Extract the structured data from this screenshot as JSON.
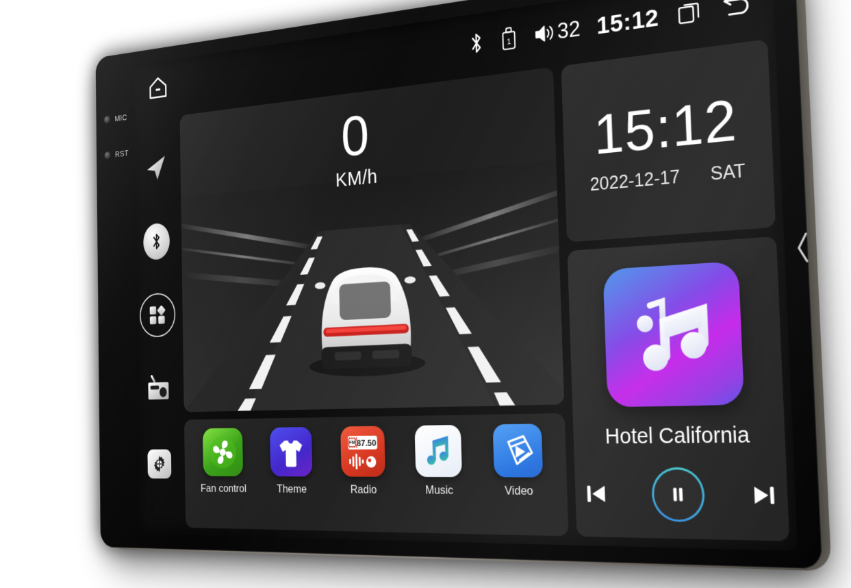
{
  "device": {
    "bezel_buttons": [
      {
        "label": "MIC",
        "name": "mic-indicator"
      },
      {
        "label": "RST",
        "name": "reset-button"
      }
    ]
  },
  "statusbar": {
    "home_icon": "home-icon",
    "bluetooth_icon": "bluetooth-icon",
    "usb_icon": "usb-drive-icon",
    "usb_label": "1",
    "volume_icon": "volume-icon",
    "volume_level": "32",
    "time": "15:12",
    "recents_icon": "recent-apps-icon",
    "back_icon": "back-icon"
  },
  "sidebar": {
    "items": [
      {
        "name": "navigation-icon",
        "label": "Navigation"
      },
      {
        "name": "bluetooth-icon",
        "label": "Bluetooth"
      },
      {
        "name": "apps-grid-icon",
        "label": "Apps"
      },
      {
        "name": "radio-icon",
        "label": "Radio"
      },
      {
        "name": "settings-gear-icon",
        "label": "Settings"
      }
    ]
  },
  "speedometer": {
    "value": "0",
    "unit": "KM/h"
  },
  "clock_widget": {
    "time": "15:12",
    "date": "2022-12-17",
    "weekday": "SAT"
  },
  "media_widget": {
    "track_title": "Hotel California",
    "album_icon": "music-note-icon",
    "prev_label": "Previous",
    "play_state": "pause",
    "next_label": "Next"
  },
  "dock": {
    "apps": [
      {
        "label": "Fan control",
        "icon": "fan-icon",
        "color": "#4caf1e"
      },
      {
        "label": "Theme",
        "icon": "tshirt-icon",
        "color": "#3a34d8"
      },
      {
        "label": "Radio",
        "icon": "radio-tuner-icon",
        "color": "#e03a20",
        "display": "87.50",
        "band": "FM"
      },
      {
        "label": "Music",
        "icon": "music-note-icon",
        "color": "#f2f5fb"
      },
      {
        "label": "Video",
        "icon": "film-play-icon",
        "color": "#2f7ef0"
      }
    ]
  },
  "colors": {
    "screen_bg": "#0b0b0b",
    "card_bg": "#1f1f1f",
    "accent": "#3fc3c6",
    "text": "#ffffff"
  }
}
